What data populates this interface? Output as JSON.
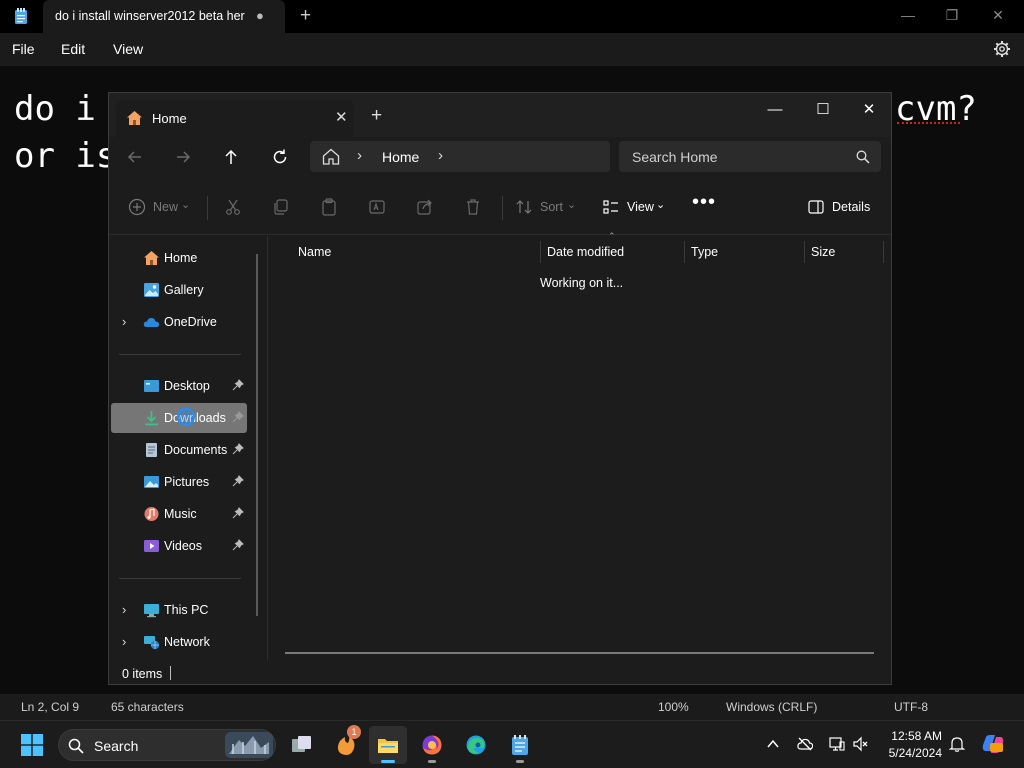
{
  "notepad": {
    "tab_title": "do i install winserver2012 beta her",
    "unsaved_indicator": "●",
    "new_tab_glyph": "+",
    "window_controls": {
      "minimize": "—",
      "maximize": "❐",
      "close": "✕"
    },
    "menu": {
      "file": "File",
      "edit": "Edit",
      "view": "View"
    },
    "visible_text": {
      "line1_left": "do i",
      "line1_right": "cvm?",
      "line2_left": "or is"
    },
    "status": {
      "position": "Ln 2, Col 9",
      "characters": "65 characters",
      "zoom": "100%",
      "line_ending": "Windows (CRLF)",
      "encoding": "UTF-8"
    }
  },
  "explorer": {
    "tab_title": "Home",
    "tab_close": "✕",
    "new_tab": "+",
    "window_controls": {
      "minimize": "—",
      "maximize": "☐",
      "close": "✕"
    },
    "address": {
      "crumb": "Home",
      "chevron": "›"
    },
    "search_placeholder": "Search Home",
    "commands": {
      "new": "New",
      "sort": "Sort",
      "view": "View",
      "more": "•••",
      "details": "Details",
      "dropdown_glyph": "⌄"
    },
    "sidebar": {
      "expander": "›",
      "home": "Home",
      "gallery": "Gallery",
      "onedrive": "OneDrive",
      "desktop": "Desktop",
      "downloads": "Downloads",
      "documents": "Documents",
      "pictures": "Pictures",
      "music": "Music",
      "videos": "Videos",
      "this_pc": "This PC",
      "network": "Network"
    },
    "columns": {
      "name": "Name",
      "date_modified": "Date modified",
      "type": "Type",
      "size": "Size",
      "sort_caret": "⌃"
    },
    "loading_text": "Working on it...",
    "status": {
      "items": "0 items"
    }
  },
  "taskbar": {
    "search_label": "Search",
    "notification_badge": "1",
    "time": "12:58 AM",
    "date": "5/24/2024"
  },
  "colors": {
    "accent": "#1e90ff",
    "selection": "#767676",
    "spellcheck": "#c42b1c"
  }
}
